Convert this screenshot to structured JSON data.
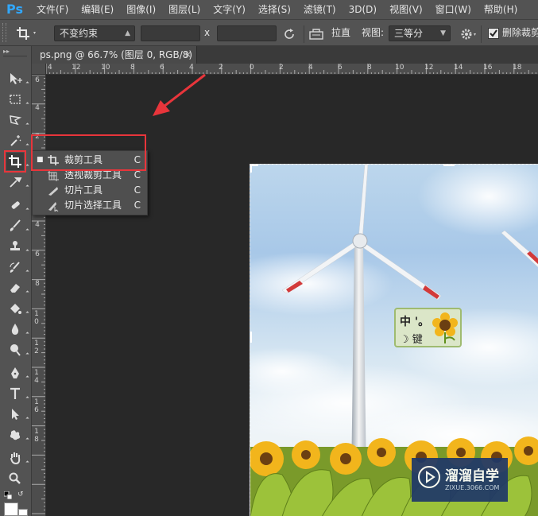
{
  "app": {
    "logo": "Ps"
  },
  "menubar": {
    "items": [
      "文件(F)",
      "编辑(E)",
      "图像(I)",
      "图层(L)",
      "文字(Y)",
      "选择(S)",
      "滤镜(T)",
      "3D(D)",
      "视图(V)",
      "窗口(W)",
      "帮助(H)"
    ]
  },
  "options": {
    "tool_icon": "crop-icon",
    "ratio_select": "不变约束",
    "width_value": "",
    "times_sign": "x",
    "height_value": "",
    "straighten_label": "拉直",
    "view_label": "视图:",
    "view_select": "三等分",
    "delete_cropped_label": "删除裁剪",
    "delete_cropped_checked": true
  },
  "document": {
    "tab_title": "ps.png @ 66.7% (图层 0, RGB/8)",
    "close_symbol": "×"
  },
  "rulers": {
    "top_labels": [
      "4",
      "12",
      "10",
      "8",
      "6",
      "4",
      "2",
      "0",
      "2",
      "4",
      "6",
      "8",
      "10",
      "12",
      "14",
      "16",
      "18"
    ],
    "left_labels": [
      "6",
      "4",
      "2",
      "0",
      "2",
      "4",
      "6",
      "8",
      "1 0",
      "1 2",
      "1 4",
      "1 6",
      "1 8"
    ]
  },
  "toolbox": {
    "tools": [
      "move-tool",
      "marquee-tool",
      "lasso-tool",
      "magic-wand-tool",
      "crop-tool",
      "eyedropper-tool",
      "healing-brush-tool",
      "brush-tool",
      "clone-stamp-tool",
      "history-brush-tool",
      "eraser-tool",
      "paint-bucket-tool",
      "blur-tool",
      "dodge-tool",
      "pen-tool",
      "type-tool",
      "path-selection-tool",
      "custom-shape-tool",
      "hand-tool",
      "zoom-tool"
    ]
  },
  "flyout": {
    "items": [
      {
        "label": "裁剪工具",
        "key": "C",
        "active": true
      },
      {
        "label": "透视裁剪工具",
        "key": "C",
        "active": false
      },
      {
        "label": "切片工具",
        "key": "C",
        "active": false
      },
      {
        "label": "切片选择工具",
        "key": "C",
        "active": false
      }
    ]
  },
  "ime": {
    "line1": "中 '。",
    "line2": "☽ 键"
  },
  "watermark": {
    "title": "溜溜自学",
    "subtitle": "ZIXUE.3066.COM"
  },
  "colors": {
    "accent_red": "#e8353b",
    "ps_blue": "#31a8ff",
    "panel_gray": "#535353"
  }
}
